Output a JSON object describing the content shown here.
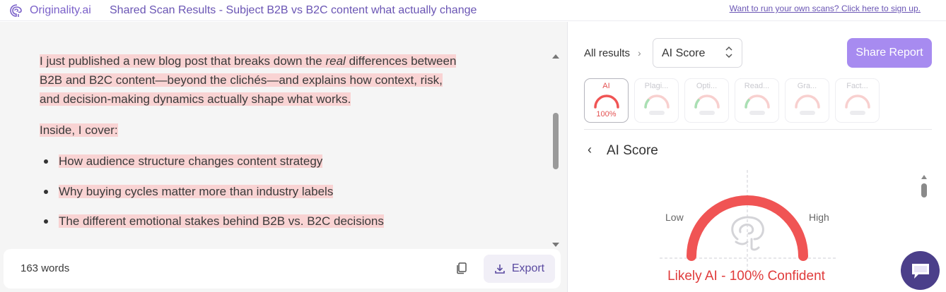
{
  "topbar": {
    "logo_text": "Originality.ai",
    "title": "Shared Scan Results - Subject B2B vs B2C content what actually change",
    "signup_link": "Want to run your own scans? Click here to sign up."
  },
  "document": {
    "para1_pre": "I just published a new blog post that breaks down the ",
    "para1_em": "real",
    "para1_post": " differences between",
    "para1_line2": "B2B and B2C content—beyond the clichés—and explains how context, risk,",
    "para1_line3": "and decision-making dynamics actually shape what works.",
    "para2": "Inside, I cover:",
    "bullets": [
      "How audience structure changes content strategy",
      "Why buying cycles matter more than industry labels",
      "The different emotional stakes behind B2B vs. B2C decisions"
    ]
  },
  "footer": {
    "word_count": "163 words",
    "export_label": "Export"
  },
  "results": {
    "breadcrumb_all": "All results",
    "breadcrumb_chevron": "›",
    "select_value": "AI Score",
    "share_label": "Share Report",
    "tabs": [
      {
        "label": "AI",
        "value": "100%",
        "active": true
      },
      {
        "label": "Plagi...",
        "active": false
      },
      {
        "label": "Opti...",
        "active": false
      },
      {
        "label": "Read...",
        "active": false
      },
      {
        "label": "Gra...",
        "active": false
      },
      {
        "label": "Fact...",
        "active": false
      }
    ],
    "section_back": "‹",
    "section_title": "AI Score",
    "gauge": {
      "low_label": "Low",
      "high_label": "High",
      "level": 1.0,
      "verdict": "Likely AI - 100% Confident"
    }
  },
  "colors": {
    "brand": "#7b61c9",
    "highlight": "#f9d3d3",
    "ai_red": "#f05454",
    "share_button": "#a78bf0",
    "chat": "#4b3f8a"
  },
  "icons": [
    "brain-logo-icon",
    "copy-icon",
    "download-icon",
    "chevron-right-icon",
    "updown-arrows-icon",
    "chevron-left-icon",
    "chat-icon"
  ]
}
